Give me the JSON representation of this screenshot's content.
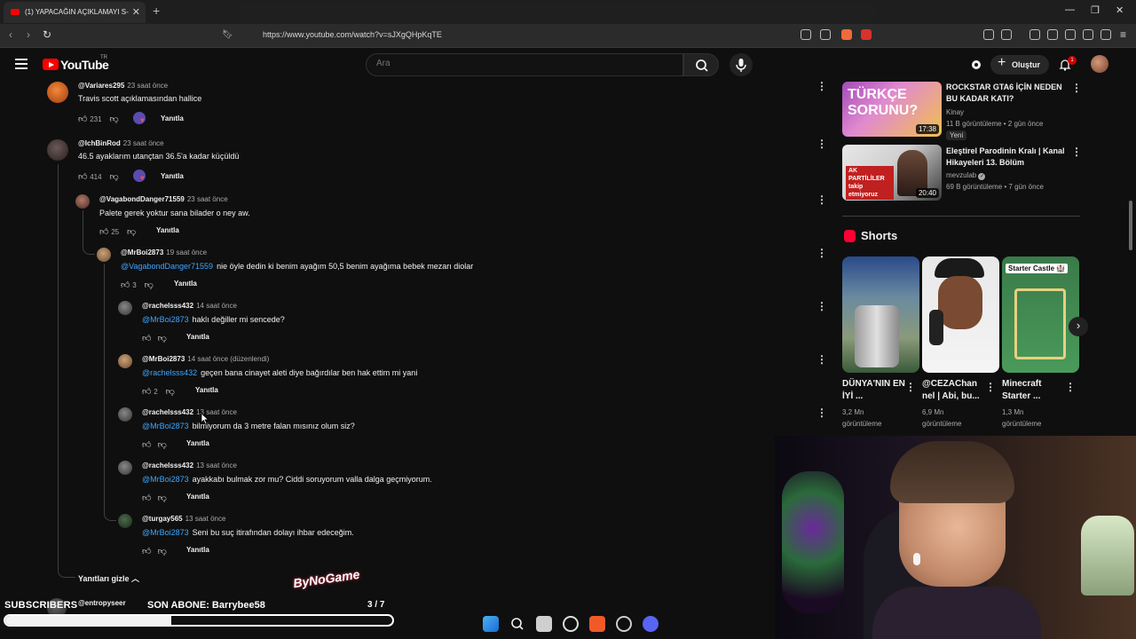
{
  "browser": {
    "tab_title": "(1) YAPACAĞIN AÇIKLAMAYI S-",
    "tab_close": "✕",
    "new_tab": "+",
    "url": "https://www.youtube.com/watch?v=sJXgQHpKqTE",
    "window_controls": [
      "—",
      "❐",
      "✕"
    ]
  },
  "header": {
    "logo_text": "YouTube",
    "region": "TR",
    "search_placeholder": "Ara",
    "create_label": "Oluştur",
    "notification_count": "1"
  },
  "comments": [
    {
      "author": "@Variares295",
      "time": "23 saat önce",
      "text": "Travis scott açıklamasından hallice",
      "likes": "231",
      "reply": "Yanıtla"
    },
    {
      "author": "@IchBinRod",
      "time": "23 saat önce",
      "text": "46.5 ayaklarım utançtan 36.5'a kadar küçüldü",
      "likes": "414",
      "reply": "Yanıtla"
    },
    {
      "author": "@VagabondDanger71559",
      "time": "23 saat önce",
      "text": "Palete gerek yoktur sana bilader o ney aw.",
      "likes": "25",
      "reply": "Yanıtla"
    },
    {
      "author": "@MrBoi2873",
      "time": "19 saat önce",
      "mention": "@VagabondDanger71559",
      "text": "nie öyle dedin ki benim ayağım 50,5 benim ayağıma bebek mezarı diolar",
      "likes": "3",
      "reply": "Yanıtla"
    },
    {
      "author": "@rachelsss432",
      "time": "14 saat önce",
      "mention": "@MrBoi2873",
      "text": "haklı değiller mi sencede?",
      "likes": "",
      "reply": "Yanıtla"
    },
    {
      "author": "@MrBoi2873",
      "time": "14 saat önce (düzenlendi)",
      "mention": "@rachelsss432",
      "text": "geçen bana cinayet aleti diye bağırdılar ben hak ettim mi yani",
      "likes": "2",
      "reply": "Yanıtla"
    },
    {
      "author": "@rachelsss432",
      "time": "13 saat önce",
      "mention": "@MrBoi2873",
      "text": "bilmiyorum da 3 metre falan mısınız olum siz?",
      "likes": "",
      "reply": "Yanıtla"
    },
    {
      "author": "@rachelsss432",
      "time": "13 saat önce",
      "mention": "@MrBoi2873",
      "text": "ayakkabı bulmak zor mu? Ciddi soruyorum valla dalga geçmiyorum.",
      "likes": "",
      "reply": "Yanıtla"
    },
    {
      "author": "@turgay565",
      "time": "13 saat önce",
      "mention": "@MrBoi2873",
      "text": "Seni bu suç itirafından dolayı ihbar edeceğim.",
      "likes": "",
      "reply": "Yanıtla"
    }
  ],
  "hide_replies": "Yanıtları gizle",
  "next_author": "@entropyseer",
  "sidebar_videos": [
    {
      "title": "ROCKSTAR GTA6 İÇİN NEDEN BU KADAR KATI?",
      "channel": "Kinay",
      "meta": "11 B görüntüleme • 2 gün önce",
      "badge": "Yeni",
      "duration": "17:38",
      "thumb_text": "TÜRKÇE SORUNU?"
    },
    {
      "title": "Eleştirel Parodinin Kralı | Kanal Hikayeleri 13. Bölüm",
      "channel": "mevzulab",
      "meta": "69 B görüntüleme • 7 gün önce",
      "duration": "20:40",
      "thumb_text": "AK PARTİLİLER takip etmiyoruz"
    }
  ],
  "shorts": {
    "title": "Shorts",
    "items": [
      {
        "title": "DÜNYA'NIN EN İYİ ...",
        "views": "3,2 Mn görüntüleme"
      },
      {
        "title": "@CEZAChan nel | Abi, bu...",
        "views": "6,9 Mn görüntüleme"
      },
      {
        "title": "Minecraft Starter ...",
        "views": "1,3 Mn görüntüleme",
        "thumb_text": "Starter Castle 🏰"
      }
    ]
  },
  "stream_overlay": {
    "subscribers_label": "SUBSCRIBERS",
    "last_sub": "SON ABONE: Barrybee58",
    "watermark": "ByNoGame",
    "count": "3 / 7",
    "progress": 0.43
  },
  "colors": {
    "accent": "#ff0000",
    "mention": "#3ea6ff",
    "bg": "#0f0f0f"
  }
}
